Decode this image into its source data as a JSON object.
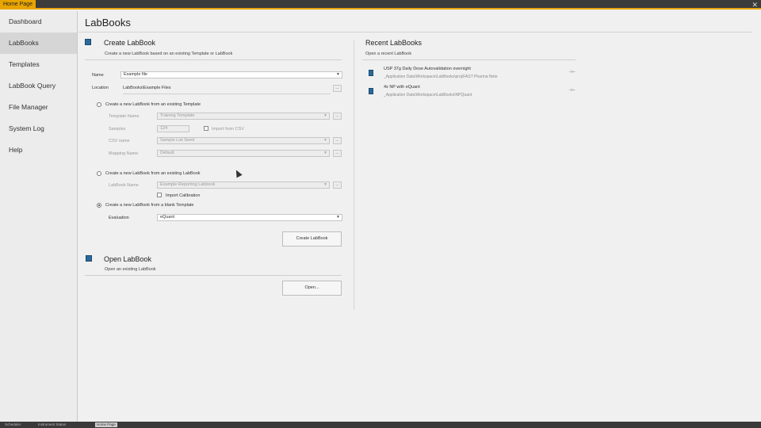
{
  "window": {
    "home_tab": "Home Page",
    "close_glyph": "✕"
  },
  "sidebar": {
    "items": [
      {
        "label": "Dashboard"
      },
      {
        "label": "LabBooks"
      },
      {
        "label": "Templates"
      },
      {
        "label": "LabBook Query"
      },
      {
        "label": "File Manager"
      },
      {
        "label": "System Log"
      },
      {
        "label": "Help"
      }
    ]
  },
  "main": {
    "title": "LabBooks"
  },
  "create": {
    "title": "Create LabBook",
    "subtitle": "Create a new LabBook based on an existing Template or LabBook",
    "name_label": "Name",
    "name_value": "Example file",
    "location_label": "Location",
    "location_value": "LabBooks\\Example Files",
    "option1_label": "Create a new LabBook from an existing Template",
    "template_name_label": "Template Name",
    "template_name_value": "Training Template",
    "samples_label": "Samples",
    "samples_value": "124",
    "import_csv_label": "Import from CSV",
    "csv_name_label": "CSV name",
    "csv_name_value": "Sample List Seed",
    "mapping_label": "Mapping Name",
    "mapping_value": "Default",
    "option2_label": "Create a new LabBook from an existing LabBook",
    "labbook_name_label": "LabBook Name",
    "labbook_name_value": "Example Reporting Labbook",
    "import_calibration_label": "Import Calibration",
    "option3_label": "Create a new LabBook from a blank Template",
    "evaluation_label": "Evaluation",
    "evaluation_value": "eQuant",
    "create_button": "Create LabBook",
    "browse_glyph": "...",
    "dropdown_glyph": "▼"
  },
  "open": {
    "title": "Open LabBook",
    "subtitle": "Open an existing LabBook",
    "button": "Open..."
  },
  "recent": {
    "title": "Recent LabBooks",
    "subtitle": "Open a recent LabBook",
    "pin_glyph": "⊣⊢",
    "items": [
      {
        "name": "USP 37g Daily Dose Autovalidation overnight",
        "path": "_Application Data\\Workspace\\LabBooks\\proj\\FAST Pharma Note"
      },
      {
        "name": "4x NP with eQuant",
        "path": "_Application Data\\Workspace\\LabBooks\\NPQuant"
      }
    ]
  },
  "taskbar": {
    "items": [
      "Scheduler",
      "Instrument Status",
      "Home Page"
    ]
  },
  "colors": {
    "accent": "#e8a500",
    "icon_blue": "#2a6a9a",
    "topbar": "#3c3c3c"
  }
}
